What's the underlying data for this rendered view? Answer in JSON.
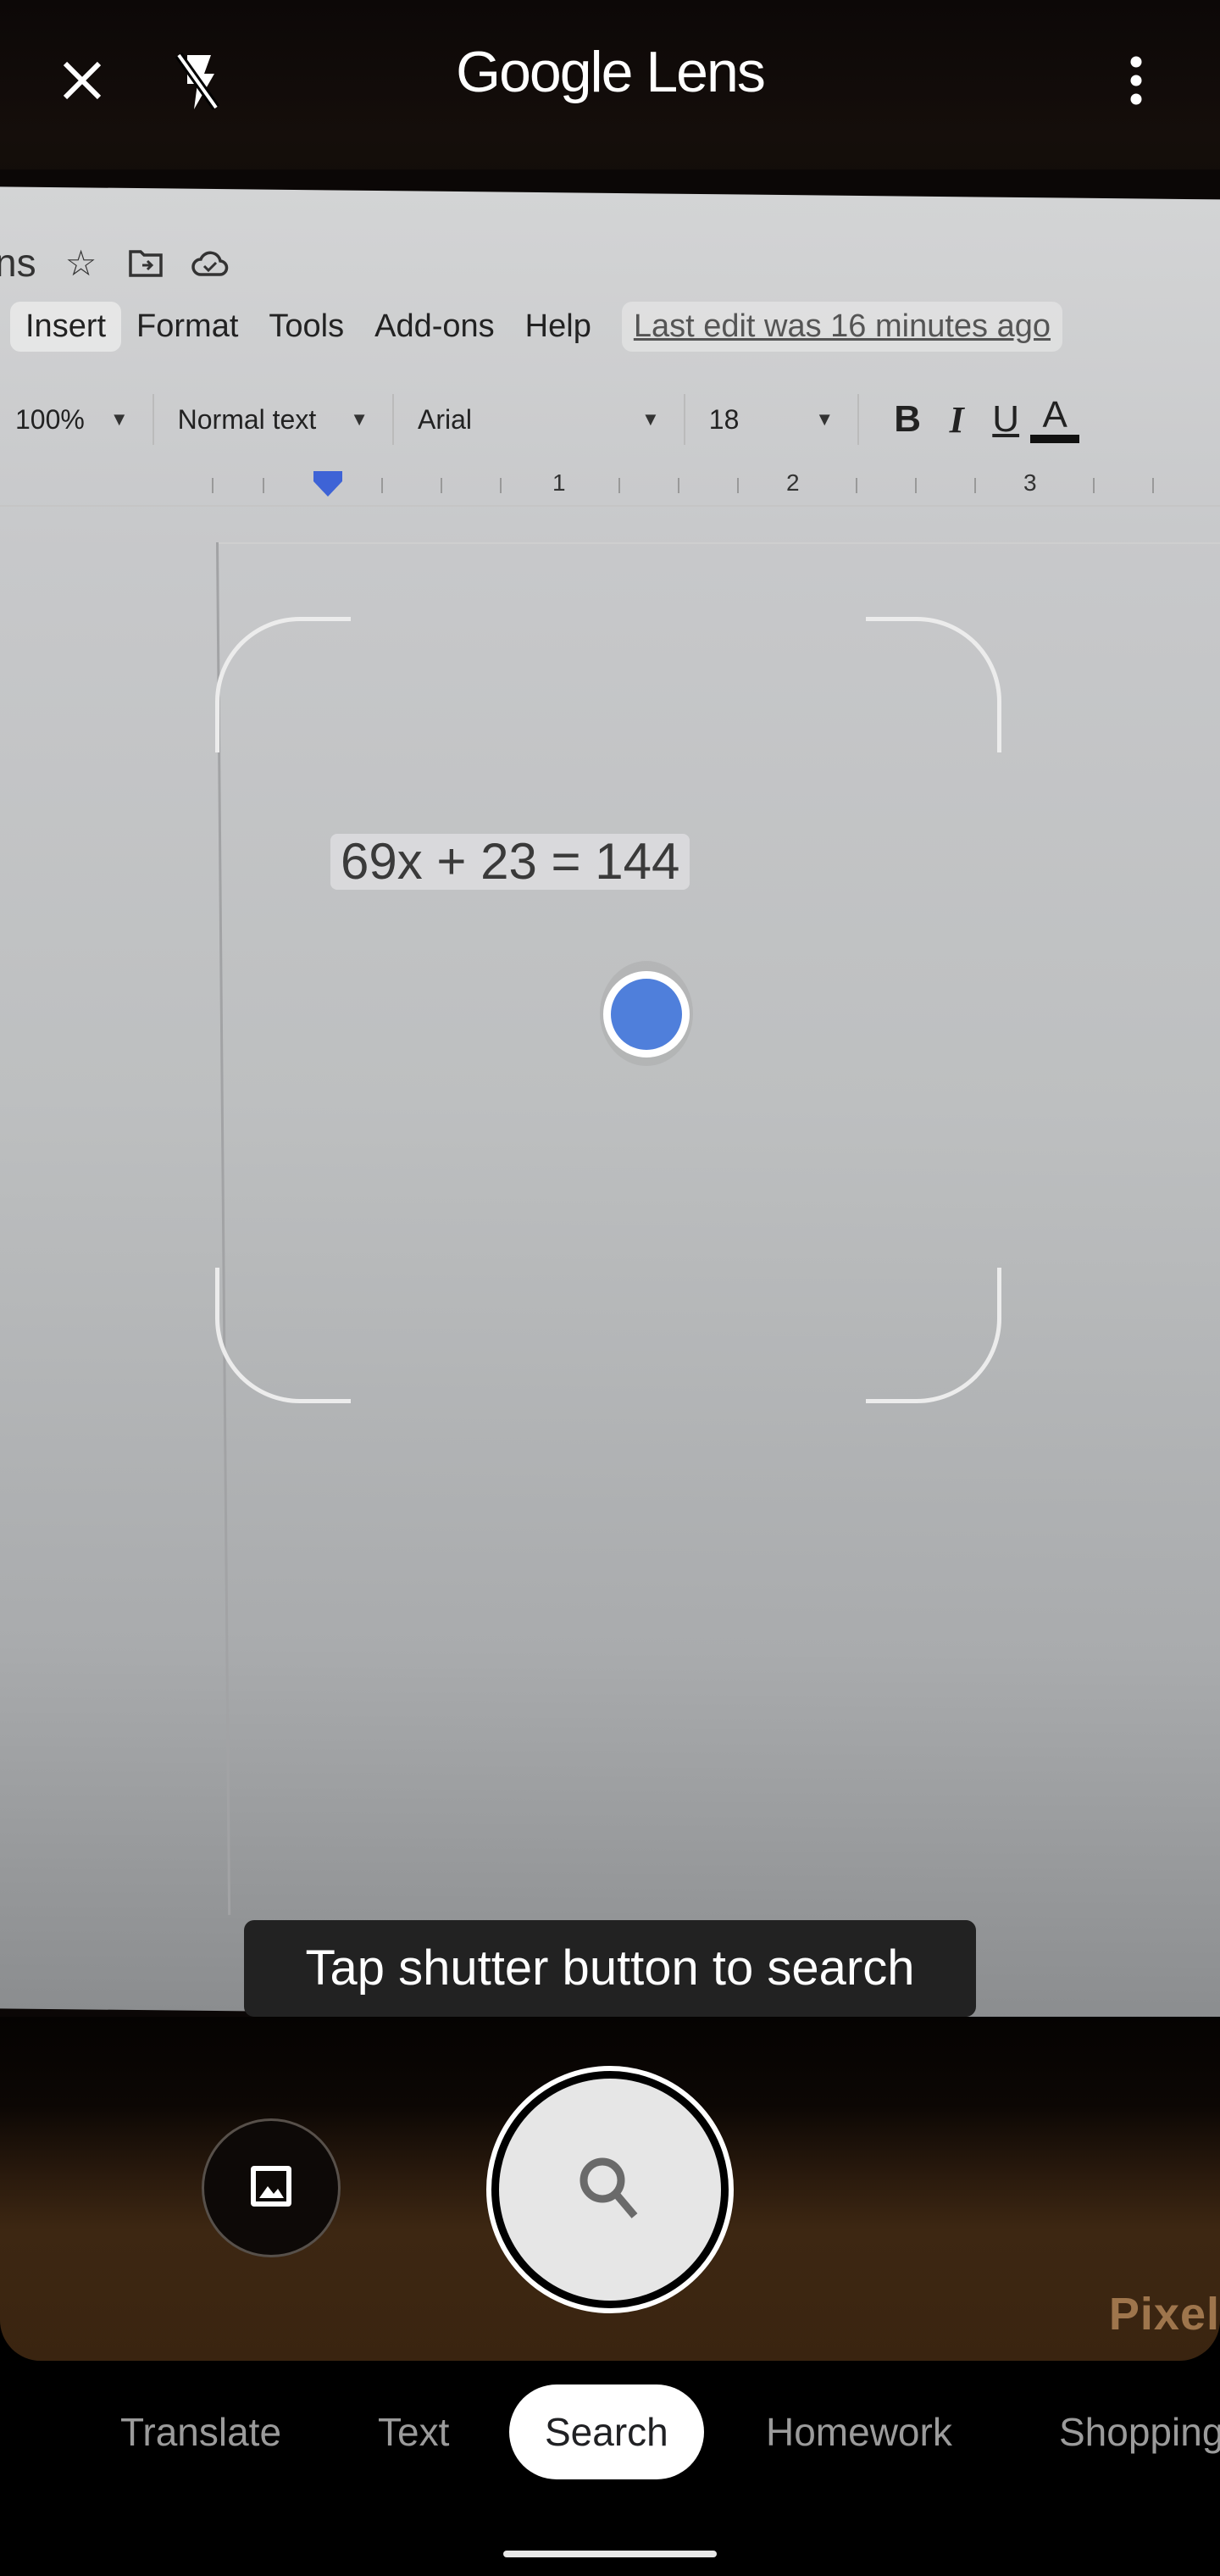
{
  "app": {
    "title_word1": "Google",
    "title_word2": "Lens",
    "close_icon": "close-icon",
    "flash_icon": "flash-off-icon",
    "more_icon": "more-vertical-icon"
  },
  "camera_view": {
    "doc_title_fragment": "ns",
    "doc_icons": [
      "star-icon",
      "move-to-folder-icon",
      "cloud-saved-icon"
    ],
    "menu_items": [
      "Insert",
      "Format",
      "Tools",
      "Add-ons",
      "Help"
    ],
    "last_edit": "Last edit was 16 minutes ago",
    "toolbar": {
      "zoom": "100%",
      "style": "Normal text",
      "font": "Arial",
      "size": "18"
    },
    "format_buttons": [
      "B",
      "I",
      "U",
      "A"
    ],
    "ruler_numbers": [
      "1",
      "2",
      "3"
    ],
    "equation": "69x + 23 = 144",
    "device_label": "Pixel"
  },
  "hint": "Tap shutter button to search",
  "controls": {
    "gallery_icon": "gallery-image-icon",
    "shutter_icon": "search-icon"
  },
  "modes": [
    {
      "label": "Translate",
      "active": false
    },
    {
      "label": "Text",
      "active": false
    },
    {
      "label": "Search",
      "active": true
    },
    {
      "label": "Homework",
      "active": false
    },
    {
      "label": "Shopping",
      "active": false
    }
  ],
  "colors": {
    "focus_dot": "#4f7fdb",
    "active_mode_bg": "#ffffff",
    "inactive_mode_text": "#9b9b9b",
    "hint_bg": "#222222"
  }
}
